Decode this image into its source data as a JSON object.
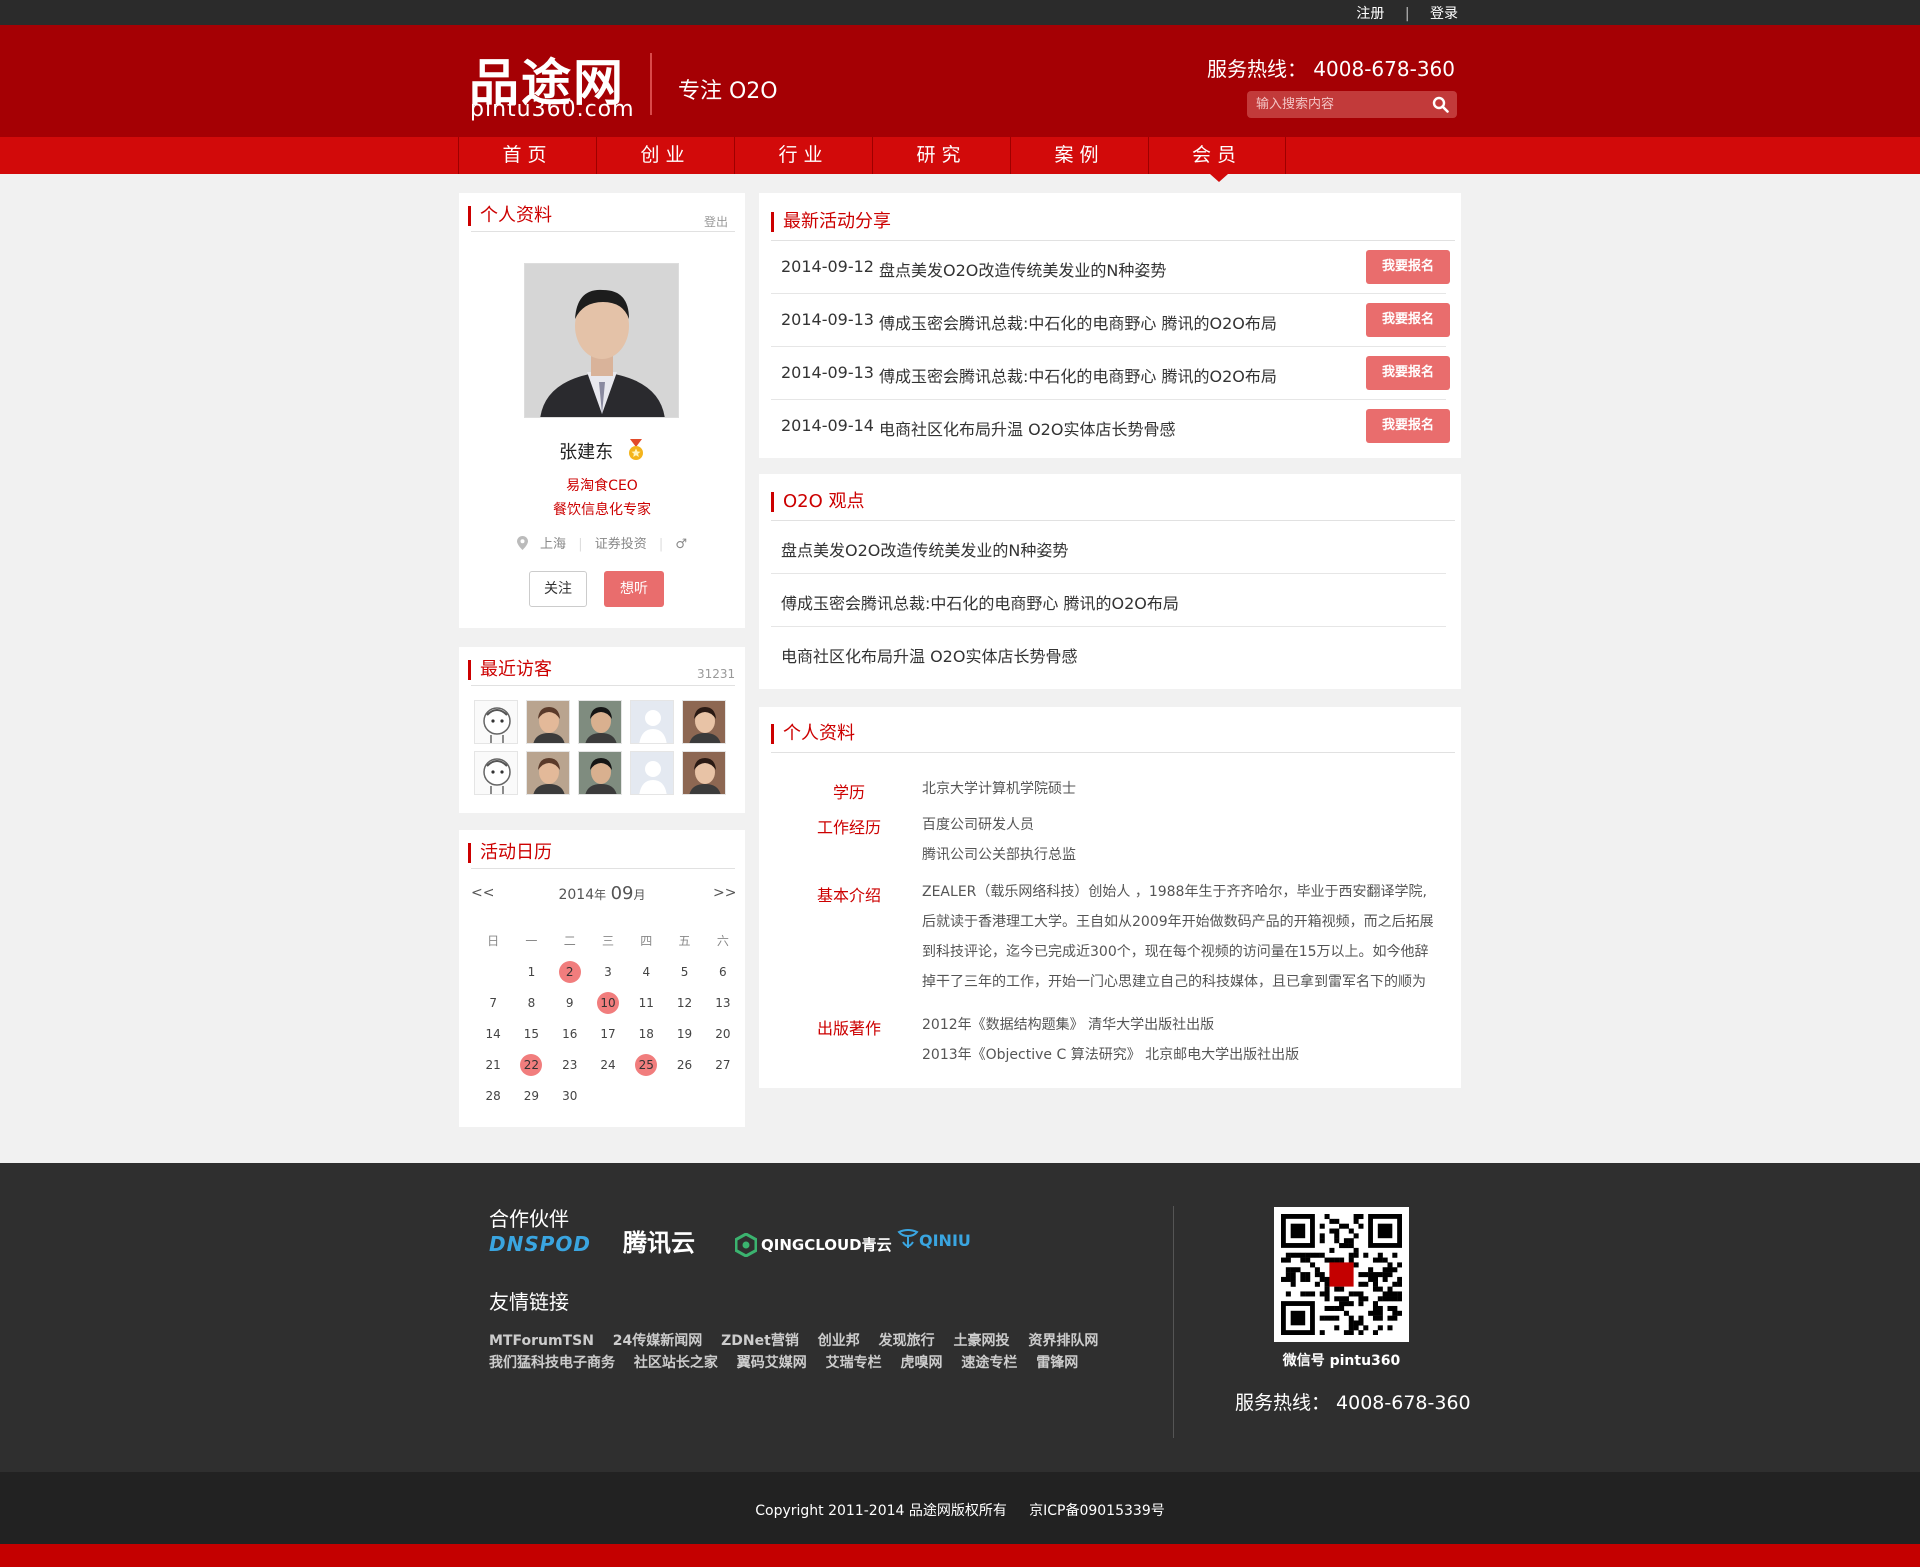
{
  "topbar": {
    "register": "注册",
    "separator": "|",
    "login": "登录"
  },
  "header": {
    "logo_main": "品途网",
    "logo_sub": "pintu360.com",
    "slogan": "专注 O2O",
    "hotline": "服务热线： 4008-678-360",
    "search_placeholder": "输入搜索内容"
  },
  "nav": [
    {
      "label": "首页"
    },
    {
      "label": "创业"
    },
    {
      "label": "行业"
    },
    {
      "label": "研究"
    },
    {
      "label": "案例"
    },
    {
      "label": "会员",
      "active": true
    }
  ],
  "profile": {
    "title": "个人资料",
    "logout": "登出",
    "name": "张建东",
    "position1": "易淘食CEO",
    "position2": "餐饮信息化专家",
    "location": "上海",
    "industry": "证券投资",
    "gender_symbol": "♂",
    "follow_label": "关注",
    "want_label": "想听"
  },
  "visitors": {
    "title": "最近访客",
    "count": "31231"
  },
  "calendar": {
    "title": "活动日历",
    "prev": "<<",
    "next": ">>",
    "year": "2014",
    "year_suffix": "年",
    "month": "09",
    "month_suffix": "月",
    "weekdays": [
      "日",
      "一",
      "二",
      "三",
      "四",
      "五",
      "六"
    ],
    "weeks": [
      [
        "",
        "1",
        "2",
        "3",
        "4",
        "5",
        "6"
      ],
      [
        "7",
        "8",
        "9",
        "10",
        "11",
        "12",
        "13"
      ],
      [
        "14",
        "15",
        "16",
        "17",
        "18",
        "19",
        "20"
      ],
      [
        "21",
        "22",
        "23",
        "24",
        "25",
        "26",
        "27"
      ],
      [
        "28",
        "29",
        "30",
        "",
        "",
        "",
        ""
      ]
    ],
    "highlighted": [
      "2",
      "10",
      "22",
      "25"
    ]
  },
  "activities": {
    "title": "最新活动分享",
    "items": [
      {
        "date": "2014-09-12",
        "title": "盘点美发O2O改造传统美发业的N种姿势",
        "button": "我要报名"
      },
      {
        "date": "2014-09-13",
        "title": "傅成玉密会腾讯总裁:中石化的电商野心 腾讯的O2O布局",
        "button": "我要报名"
      },
      {
        "date": "2014-09-13",
        "title": "傅成玉密会腾讯总裁:中石化的电商野心 腾讯的O2O布局",
        "button": "我要报名"
      },
      {
        "date": "2014-09-14",
        "title": "电商社区化布局升温 O2O实体店长势骨感",
        "button": "我要报名"
      }
    ]
  },
  "opinions": {
    "title": "O2O 观点",
    "items": [
      "盘点美发O2O改造传统美发业的N种姿势",
      "傅成玉密会腾讯总裁:中石化的电商野心 腾讯的O2O布局",
      "电商社区化布局升温 O2O实体店长势骨感"
    ]
  },
  "info": {
    "title": "个人资料",
    "education_label": "学历",
    "education": "北京大学计算机学院硕士",
    "work_label": "工作经历",
    "work1": "百度公司研发人员",
    "work2": "腾讯公司公关部执行总监",
    "intro_label": "基本介绍",
    "intro1": "ZEALER（载乐网络科技）创始人 ，1988年生于齐齐哈尔，毕业于西安翻译学院,",
    "intro2": "后就读于香港理工大学。王自如从2009年开始做数码产品的开箱视频，而之后拓展",
    "intro3": "到科技评论，迄今已完成近300个，现在每个视频的访问量在15万以上。如今他辞",
    "intro4": "掉干了三年的工作，开始一门心思建立自己的科技媒体，且已拿到雷军名下的顺为",
    "works_label": "出版著作",
    "work_pub1": "2012年《数据结构题集》 清华大学出版社出版",
    "work_pub2": "2013年《Objective C 算法研究》 北京邮电大学出版社出版"
  },
  "footer": {
    "partners_title": "合作伙伴",
    "partners": [
      "DNSPOD",
      "腾讯云",
      "QINGCLOUD青云",
      "QINIU"
    ],
    "links_title": "友情链接",
    "links_row1": [
      "MTForumTSN",
      "24传媒新闻网",
      "ZDNet营销",
      "创业邦",
      "发现旅行",
      "土豪网投",
      "资界排队网"
    ],
    "links_row2": [
      "我们猛科技电子商务",
      "社区站长之家",
      "翼码艾媒网",
      "艾瑞专栏",
      "虎嗅网",
      "速途专栏",
      "雷锋网"
    ],
    "wechat": "微信号 pintu360",
    "hotline": "服务热线： 4008-678-360",
    "copyright": "Copyright 2011-2014 品途网版权所有     京ICP备09015339号"
  },
  "colors": {
    "brand_red": "#a50004",
    "nav_red": "#d20a0a",
    "button_pink": "#e96d6d"
  }
}
